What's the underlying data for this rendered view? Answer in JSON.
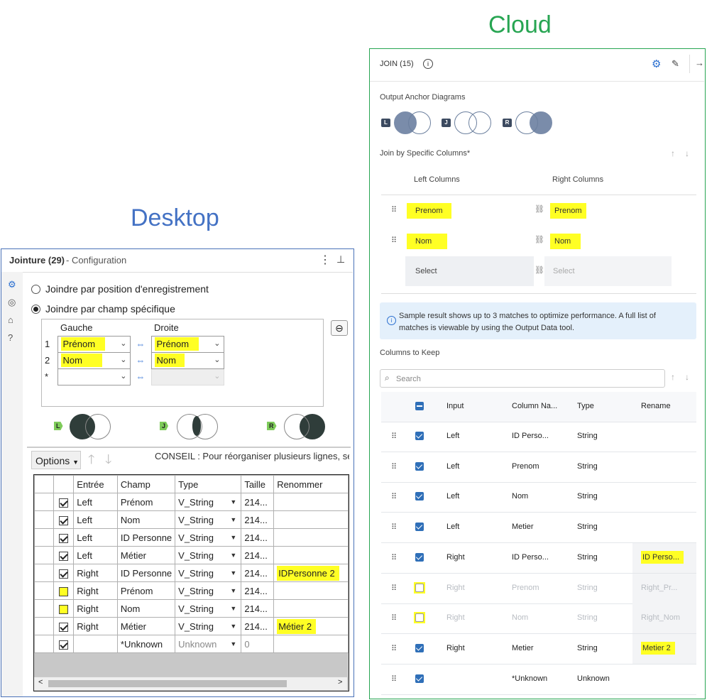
{
  "captions": {
    "desktop": "Desktop",
    "cloud": "Cloud"
  },
  "colors": {
    "desktop_border": "#4a72b8",
    "cloud_border": "#27a552",
    "highlight": "#ffff24",
    "caption_desktop": "#4472c4",
    "caption_cloud": "#27a552"
  },
  "desktop": {
    "header": {
      "title": "Jointure (29)",
      "subtitle": "- Configuration",
      "menu_icon": "kebab-icon",
      "pin_icon": "pin-icon"
    },
    "sidebar_icons": [
      "gear-icon",
      "anchor-icon",
      "tag-icon",
      "help-icon"
    ],
    "radios": [
      {
        "label": "Joindre par position d'enregistrement",
        "selected": false
      },
      {
        "label": "Joindre par champ spécifique",
        "selected": true
      }
    ],
    "join_grid": {
      "headers": {
        "left": "Gauche",
        "right": "Droite"
      },
      "rows": [
        {
          "num": "1",
          "left": "Prénom",
          "right": "Prénom"
        },
        {
          "num": "2",
          "left": "Nom",
          "right": "Nom"
        },
        {
          "num": "*",
          "left": "",
          "right": ""
        }
      ],
      "remove_icon": "minus-circle-icon"
    },
    "anchors": [
      "L",
      "J",
      "R"
    ],
    "toolbar": {
      "options_label": "Options",
      "hint": "CONSEIL : Pour réorganiser plusieurs lignes, sélect"
    },
    "fields": {
      "headers": [
        "",
        "Entrée",
        "Champ",
        "Type",
        "Taille",
        "Renommer"
      ],
      "rows": [
        {
          "checked": true,
          "input": "Left",
          "field": "Prénom",
          "type": "V_String",
          "size": "214...",
          "rename": ""
        },
        {
          "checked": true,
          "input": "Left",
          "field": "Nom",
          "type": "V_String",
          "size": "214...",
          "rename": ""
        },
        {
          "checked": true,
          "input": "Left",
          "field": "ID Personne",
          "type": "V_String",
          "size": "214...",
          "rename": ""
        },
        {
          "checked": true,
          "input": "Left",
          "field": "Métier",
          "type": "V_String",
          "size": "214...",
          "rename": ""
        },
        {
          "checked": true,
          "input": "Right",
          "field": "ID Personne",
          "type": "V_String",
          "size": "214...",
          "rename": "IDPersonne 2"
        },
        {
          "checked": false,
          "input": "Right",
          "field": "Prénom",
          "type": "V_String",
          "size": "214...",
          "rename": ""
        },
        {
          "checked": false,
          "input": "Right",
          "field": "Nom",
          "type": "V_String",
          "size": "214...",
          "rename": ""
        },
        {
          "checked": true,
          "input": "Right",
          "field": "Métier",
          "type": "V_String",
          "size": "214...",
          "rename": "Métier 2"
        },
        {
          "checked": true,
          "input": "",
          "field": "*Unknown",
          "type": "Unknown",
          "size": "0",
          "rename": ""
        }
      ]
    }
  },
  "cloud": {
    "header": {
      "title": "JOIN (15)",
      "info_icon": "info-icon",
      "gear_icon": "gear-icon",
      "pin_icon": "pin-icon",
      "collapse_icon": "arrow-right-icon"
    },
    "output_anchor_label": "Output Anchor Diagrams",
    "anchors": [
      "L",
      "J",
      "R"
    ],
    "join_label": "Join by Specific Columns*",
    "columns_headers": {
      "left": "Left Columns",
      "right": "Right Columns"
    },
    "join_rows": [
      {
        "left": "Prenom",
        "right": "Prenom"
      },
      {
        "left": "Nom",
        "right": "Nom"
      }
    ],
    "select_placeholder": "Select",
    "info_text": "Sample result shows up to 3 matches to optimize performance. A full list of matches is viewable by using the Output Data tool.",
    "keep_label": "Columns to Keep",
    "search_placeholder": "Search",
    "table_headers": [
      "Input",
      "Column Na...",
      "Type",
      "Rename"
    ],
    "rows": [
      {
        "checked": true,
        "input": "Left",
        "column": "ID Perso...",
        "type": "String",
        "rename": ""
      },
      {
        "checked": true,
        "input": "Left",
        "column": "Prenom",
        "type": "String",
        "rename": ""
      },
      {
        "checked": true,
        "input": "Left",
        "column": "Nom",
        "type": "String",
        "rename": ""
      },
      {
        "checked": true,
        "input": "Left",
        "column": "Metier",
        "type": "String",
        "rename": ""
      },
      {
        "checked": true,
        "input": "Right",
        "column": "ID Perso...",
        "type": "String",
        "rename": "ID Perso..."
      },
      {
        "checked": false,
        "input": "Right",
        "column": "Prenom",
        "type": "String",
        "rename": "Right_Pr..."
      },
      {
        "checked": false,
        "input": "Right",
        "column": "Nom",
        "type": "String",
        "rename": "Right_Nom"
      },
      {
        "checked": true,
        "input": "Right",
        "column": "Metier",
        "type": "String",
        "rename": "Metier 2"
      },
      {
        "checked": true,
        "input": "",
        "column": "*Unknown",
        "type": "Unknown",
        "rename": ""
      }
    ]
  }
}
